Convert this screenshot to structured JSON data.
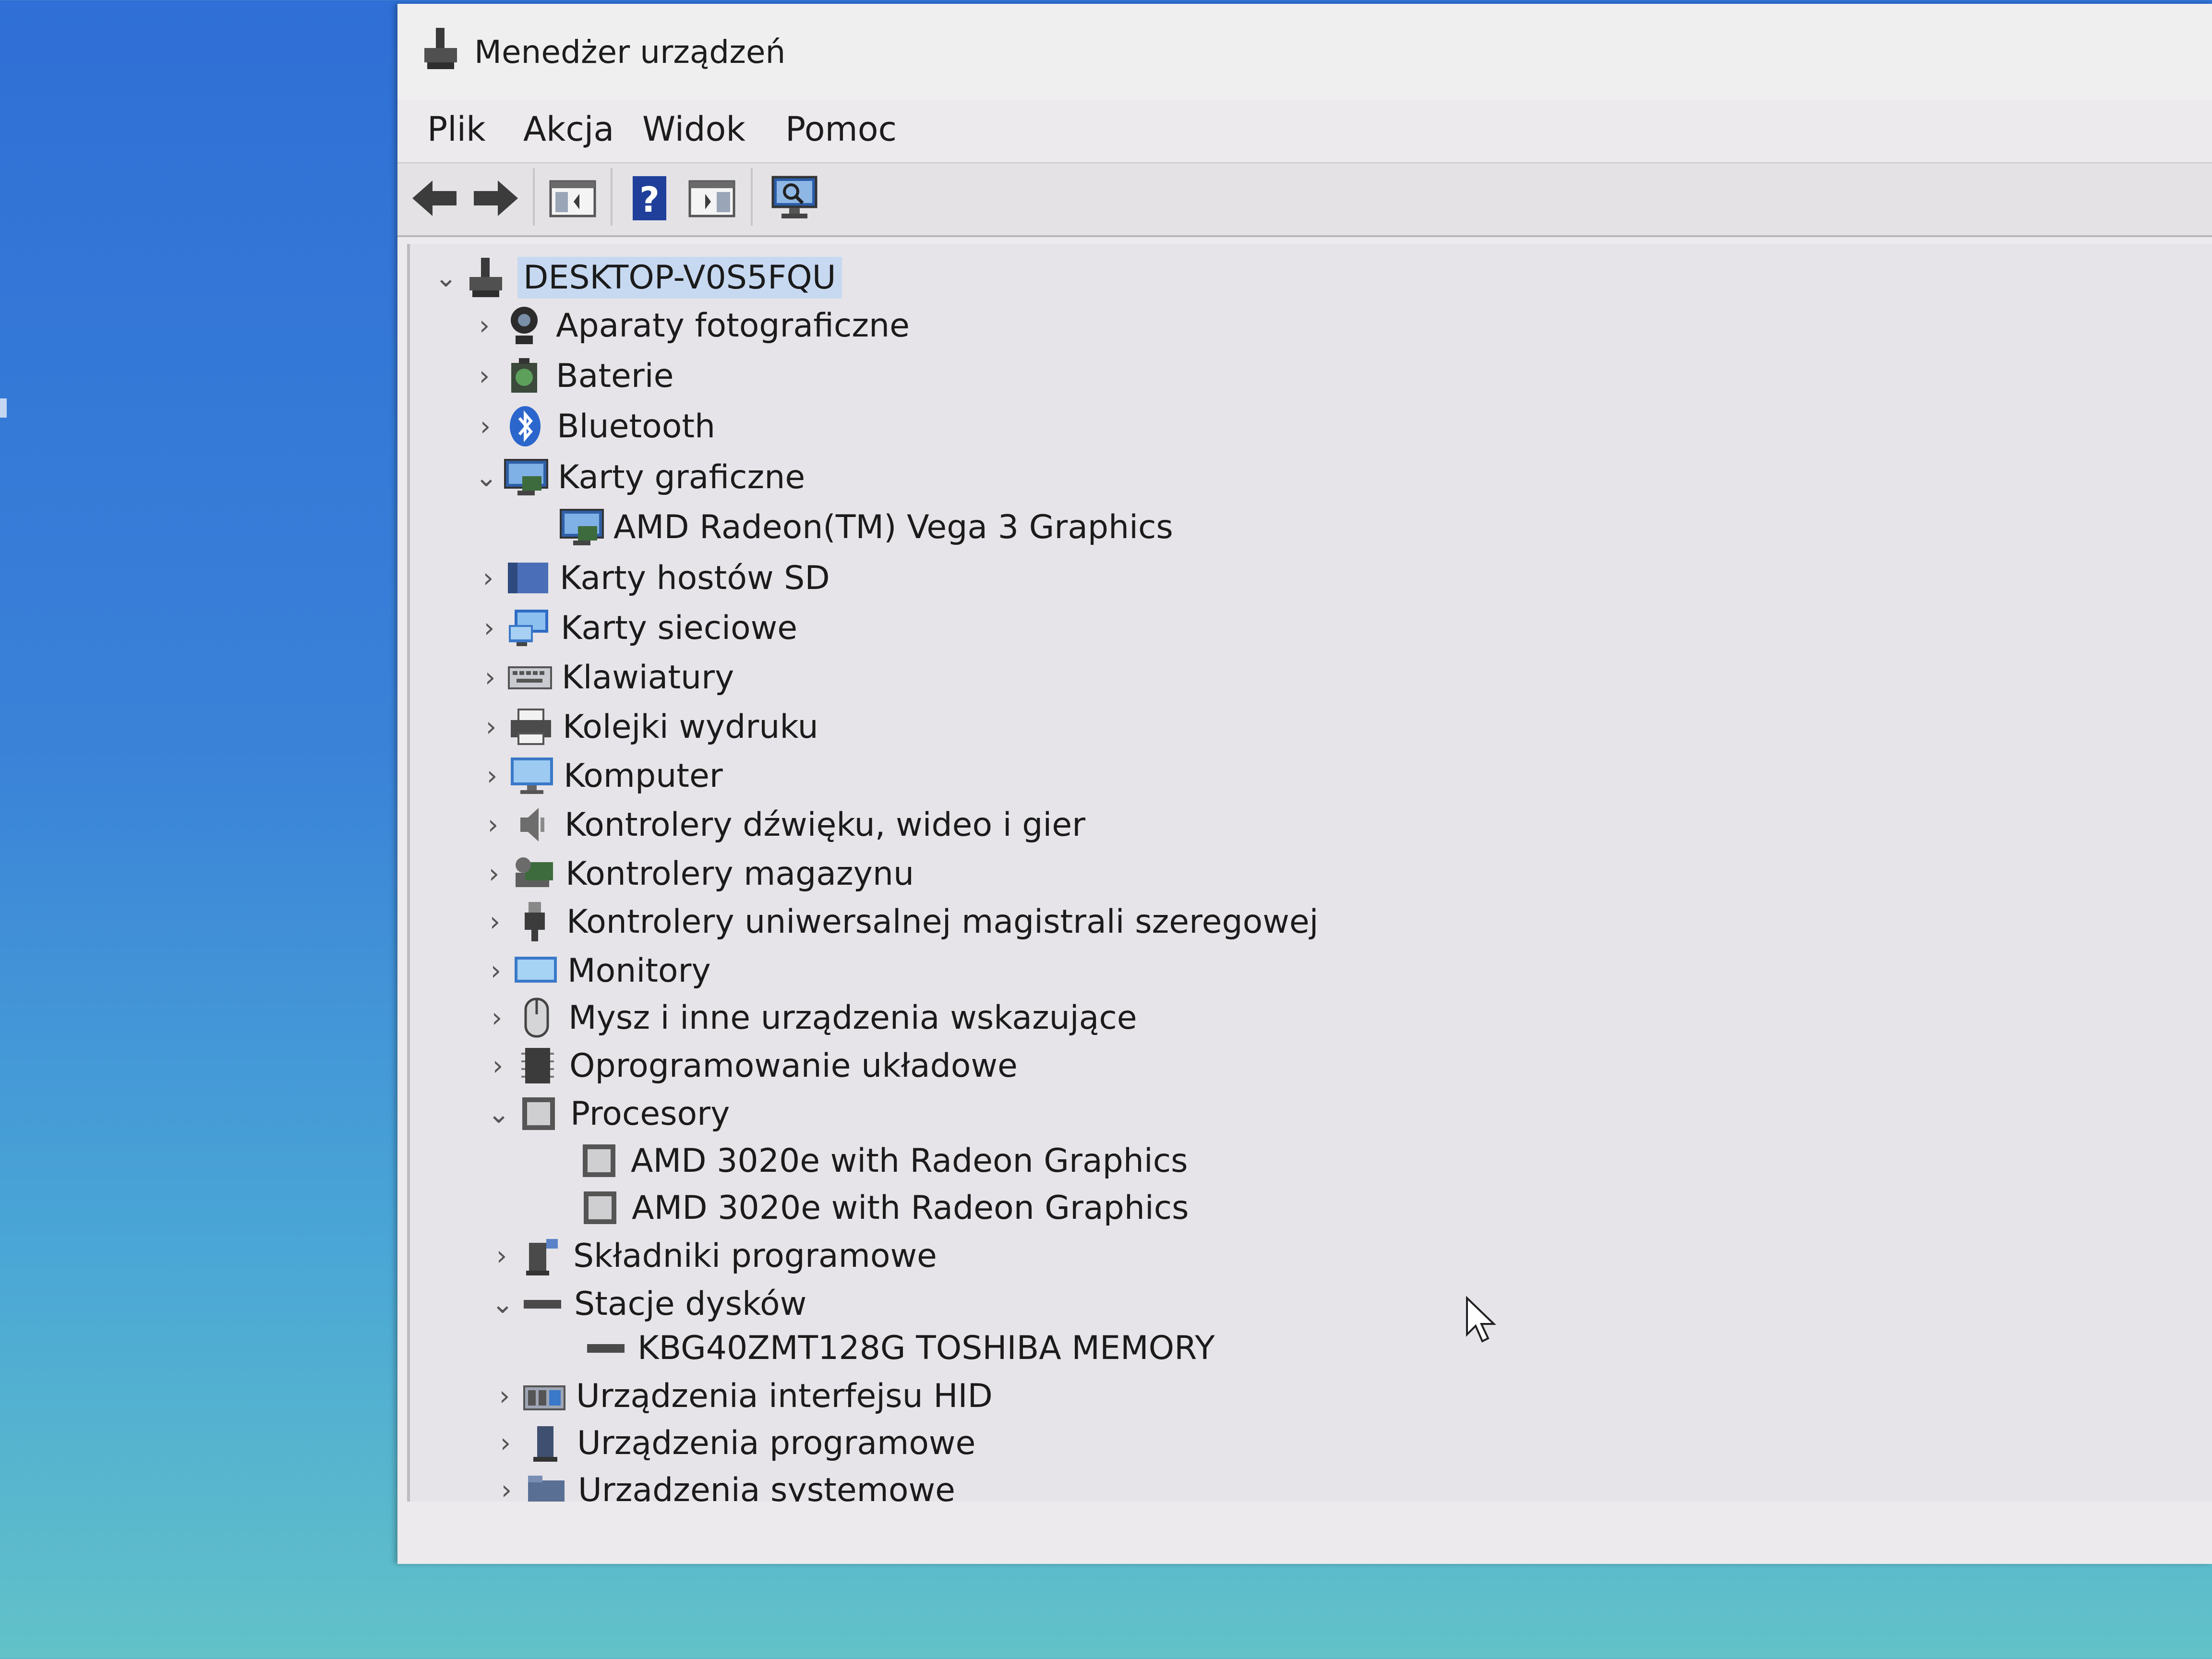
{
  "window": {
    "title": "Menedżer urządzeń"
  },
  "menu": [
    "Plik",
    "Akcja",
    "Widok",
    "Pomoc"
  ],
  "toolbar": {
    "icons": [
      "back-arrow-icon",
      "forward-arrow-icon",
      "show-hide-console-tree-icon",
      "help-icon",
      "properties-pane-icon",
      "scan-hardware-monitor-icon"
    ]
  },
  "tree": {
    "root": "DESKTOP-V0S5FQU",
    "nodes": [
      {
        "label": "Aparaty fotograficzne",
        "icon": "camera-icon",
        "expanded": false,
        "level": 1
      },
      {
        "label": "Baterie",
        "icon": "battery-icon",
        "expanded": false,
        "level": 1
      },
      {
        "label": "Bluetooth",
        "icon": "bluetooth-icon",
        "expanded": false,
        "level": 1
      },
      {
        "label": "Karty graficzne",
        "icon": "display-adapter-icon",
        "expanded": true,
        "level": 1
      },
      {
        "label": "AMD Radeon(TM) Vega 3 Graphics",
        "icon": "display-adapter-icon",
        "level": 2
      },
      {
        "label": "Karty hostów SD",
        "icon": "sd-host-icon",
        "expanded": false,
        "level": 1
      },
      {
        "label": "Karty sieciowe",
        "icon": "network-adapter-icon",
        "expanded": false,
        "level": 1
      },
      {
        "label": "Klawiatury",
        "icon": "keyboard-icon",
        "expanded": false,
        "level": 1
      },
      {
        "label": "Kolejki wydruku",
        "icon": "printer-icon",
        "expanded": false,
        "level": 1
      },
      {
        "label": "Komputer",
        "icon": "computer-icon",
        "expanded": false,
        "level": 1
      },
      {
        "label": "Kontrolery dźwięku, wideo i gier",
        "icon": "speaker-icon",
        "expanded": false,
        "level": 1
      },
      {
        "label": "Kontrolery magazynu",
        "icon": "storage-controller-icon",
        "expanded": false,
        "level": 1
      },
      {
        "label": "Kontrolery uniwersalnej magistrali szeregowej",
        "icon": "usb-plug-icon",
        "expanded": false,
        "level": 1
      },
      {
        "label": "Monitory",
        "icon": "monitor-icon",
        "expanded": false,
        "level": 1
      },
      {
        "label": "Mysz i inne urządzenia wskazujące",
        "icon": "mouse-icon",
        "expanded": false,
        "level": 1
      },
      {
        "label": "Oprogramowanie układowe",
        "icon": "firmware-chip-icon",
        "expanded": false,
        "level": 1
      },
      {
        "label": "Procesory",
        "icon": "processor-icon",
        "expanded": true,
        "level": 1
      },
      {
        "label": "AMD 3020e with Radeon Graphics",
        "icon": "processor-icon",
        "level": 2
      },
      {
        "label": "AMD 3020e with Radeon Graphics",
        "icon": "processor-icon",
        "level": 2
      },
      {
        "label": "Składniki programowe",
        "icon": "software-component-icon",
        "expanded": false,
        "level": 1
      },
      {
        "label": "Stacje dysków",
        "icon": "disk-drive-icon",
        "expanded": true,
        "level": 1
      },
      {
        "label": "KBG40ZMT128G TOSHIBA MEMORY",
        "icon": "disk-drive-icon",
        "level": 2
      },
      {
        "label": "Urządzenia interfejsu HID",
        "icon": "hid-icon",
        "expanded": false,
        "level": 1
      },
      {
        "label": "Urządzenia programowe",
        "icon": "software-device-icon",
        "expanded": false,
        "level": 1
      },
      {
        "label": "Urządzenia systemowe",
        "icon": "system-device-icon",
        "expanded": false,
        "level": 1
      }
    ]
  },
  "colors": {
    "selection": "#c7d9f1",
    "window_bg": "#eceaec",
    "desktop": "#3a82d8"
  }
}
